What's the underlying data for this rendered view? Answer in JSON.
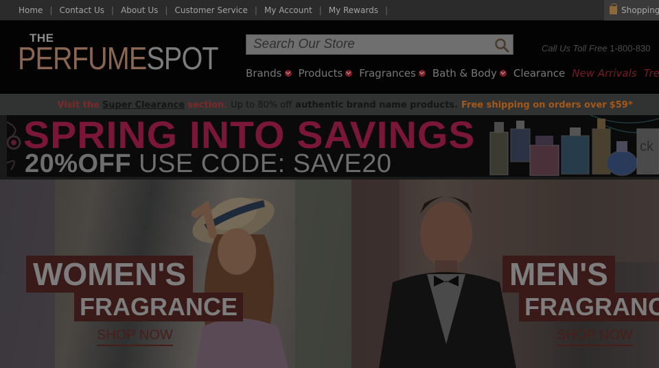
{
  "topbar": {
    "links": [
      "Home",
      "Contact Us",
      "About Us",
      "Customer Service",
      "My Account",
      "My Rewards"
    ],
    "separator": "|",
    "cart_label": "Shopping"
  },
  "header": {
    "logo_the": "THE",
    "logo_perfume": "PERFUME",
    "logo_spot": "SPOT",
    "search_placeholder": "Search Our Store",
    "phone_label": "Call Us Toll Free",
    "phone_number": "1-800-830"
  },
  "nav": {
    "items": [
      {
        "label": "Brands",
        "dropdown": true
      },
      {
        "label": "Products",
        "dropdown": true
      },
      {
        "label": "Fragrances",
        "dropdown": true
      },
      {
        "label": "Bath & Body",
        "dropdown": true
      },
      {
        "label": "Clearance",
        "dropdown": false
      }
    ],
    "new_arrivals": "New Arrivals",
    "trending": "Trend"
  },
  "promo": {
    "visit": "Visit the",
    "link": "Super Clearance",
    "section": "section.",
    "up_to": "Up to 80% off",
    "authentic": "authentic brand name products.",
    "shipping": "Free shipping on orders over",
    "amount": "$59*"
  },
  "banner": {
    "line1": "SPRING INTO SAVINGS",
    "line2_bold": "20%OFF",
    "line2_rest": "USE CODE: SAVE20"
  },
  "hero": {
    "women_line1": "WOMEN'S",
    "women_line2": "FRAGRANCE",
    "women_cta": "SHOP NOW",
    "men_line1": "MEN'S",
    "men_line2": "FRAGRANC",
    "men_cta": "SHOP NOW"
  },
  "colors": {
    "accent_red": "#7a1a24",
    "banner_pink": "#7a1638",
    "tag_red": "#3a1a18"
  }
}
